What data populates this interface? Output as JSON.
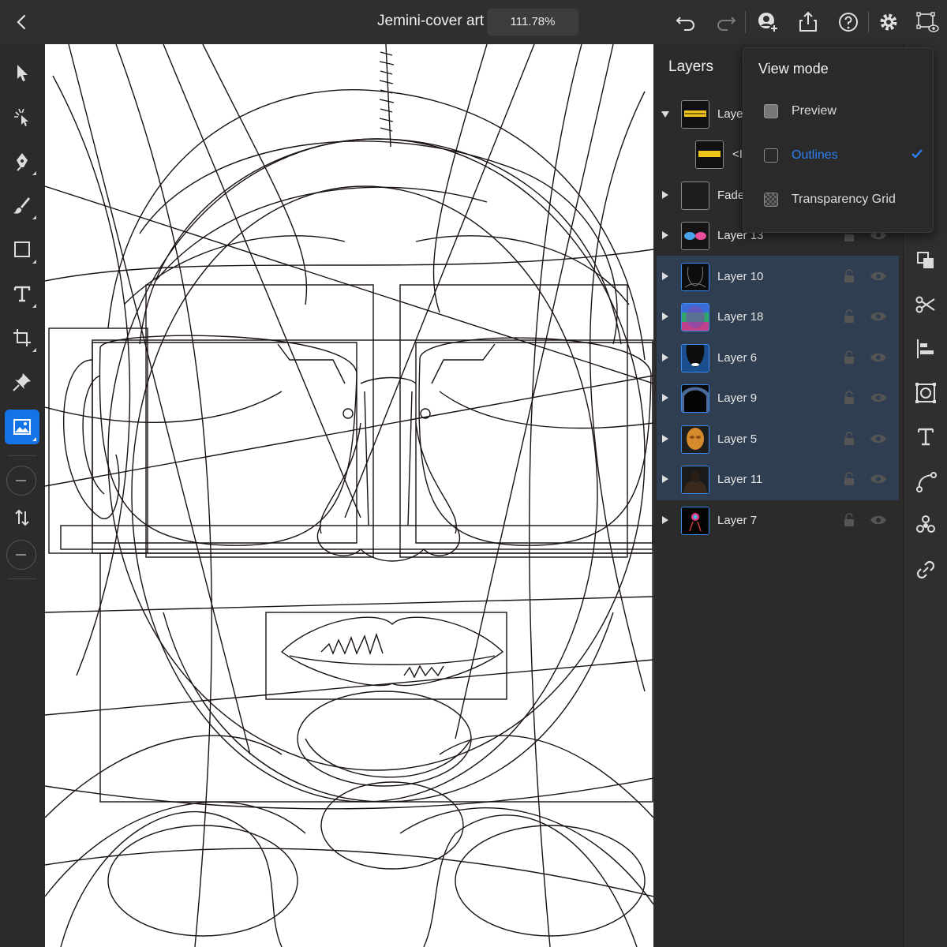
{
  "header": {
    "title": "Jemini-cover art",
    "zoom": "111.78%",
    "icons": [
      "back-icon",
      "undo-icon",
      "redo-icon",
      "invite-icon",
      "share-icon",
      "help-icon",
      "settings-icon",
      "view-mode-icon"
    ]
  },
  "left_toolbar": {
    "tools": [
      "select-icon",
      "touch-modifier-icon",
      "pen-icon",
      "brush-icon",
      "shape-icon",
      "type-icon",
      "transform-icon",
      "pin-icon",
      "image-icon",
      "reorder-icon"
    ],
    "active_tool": "image-icon"
  },
  "layers_panel": {
    "title": "Layers",
    "layers": [
      {
        "name": "Layer",
        "expanded": true,
        "thumb": "logo"
      },
      {
        "name": "<I",
        "child": true,
        "thumb": "logo"
      },
      {
        "name": "Fade",
        "thumb": "dark"
      },
      {
        "name": "Layer 13",
        "thumb": "glasses"
      },
      {
        "name": "Layer 10",
        "selected": true,
        "thumb": "lines"
      },
      {
        "name": "Layer 18",
        "selected": true,
        "thumb": "gradient"
      },
      {
        "name": "Layer 6",
        "selected": true,
        "thumb": "face-dark"
      },
      {
        "name": "Layer 9",
        "selected": true,
        "thumb": "silhouette"
      },
      {
        "name": "Layer 5",
        "selected": true,
        "thumb": "orange-face"
      },
      {
        "name": "Layer 11",
        "selected": true,
        "thumb": "figure"
      },
      {
        "name": "Layer 7",
        "thumb": "neon"
      }
    ]
  },
  "view_mode": {
    "title": "View mode",
    "options": [
      {
        "label": "Preview",
        "selected": false
      },
      {
        "label": "Outlines",
        "selected": true
      },
      {
        "label": "Transparency Grid",
        "selected": false
      }
    ]
  },
  "right_toolbar": {
    "tools": [
      "arrange-icon",
      "cut-icon",
      "align-icon",
      "mask-icon",
      "text-on-path-icon",
      "path-icon",
      "repeat-icon",
      "link-icon"
    ]
  },
  "colors": {
    "accent": "#1473e6",
    "selection": "#2f3e50",
    "link_blue": "#2d7ff0"
  }
}
